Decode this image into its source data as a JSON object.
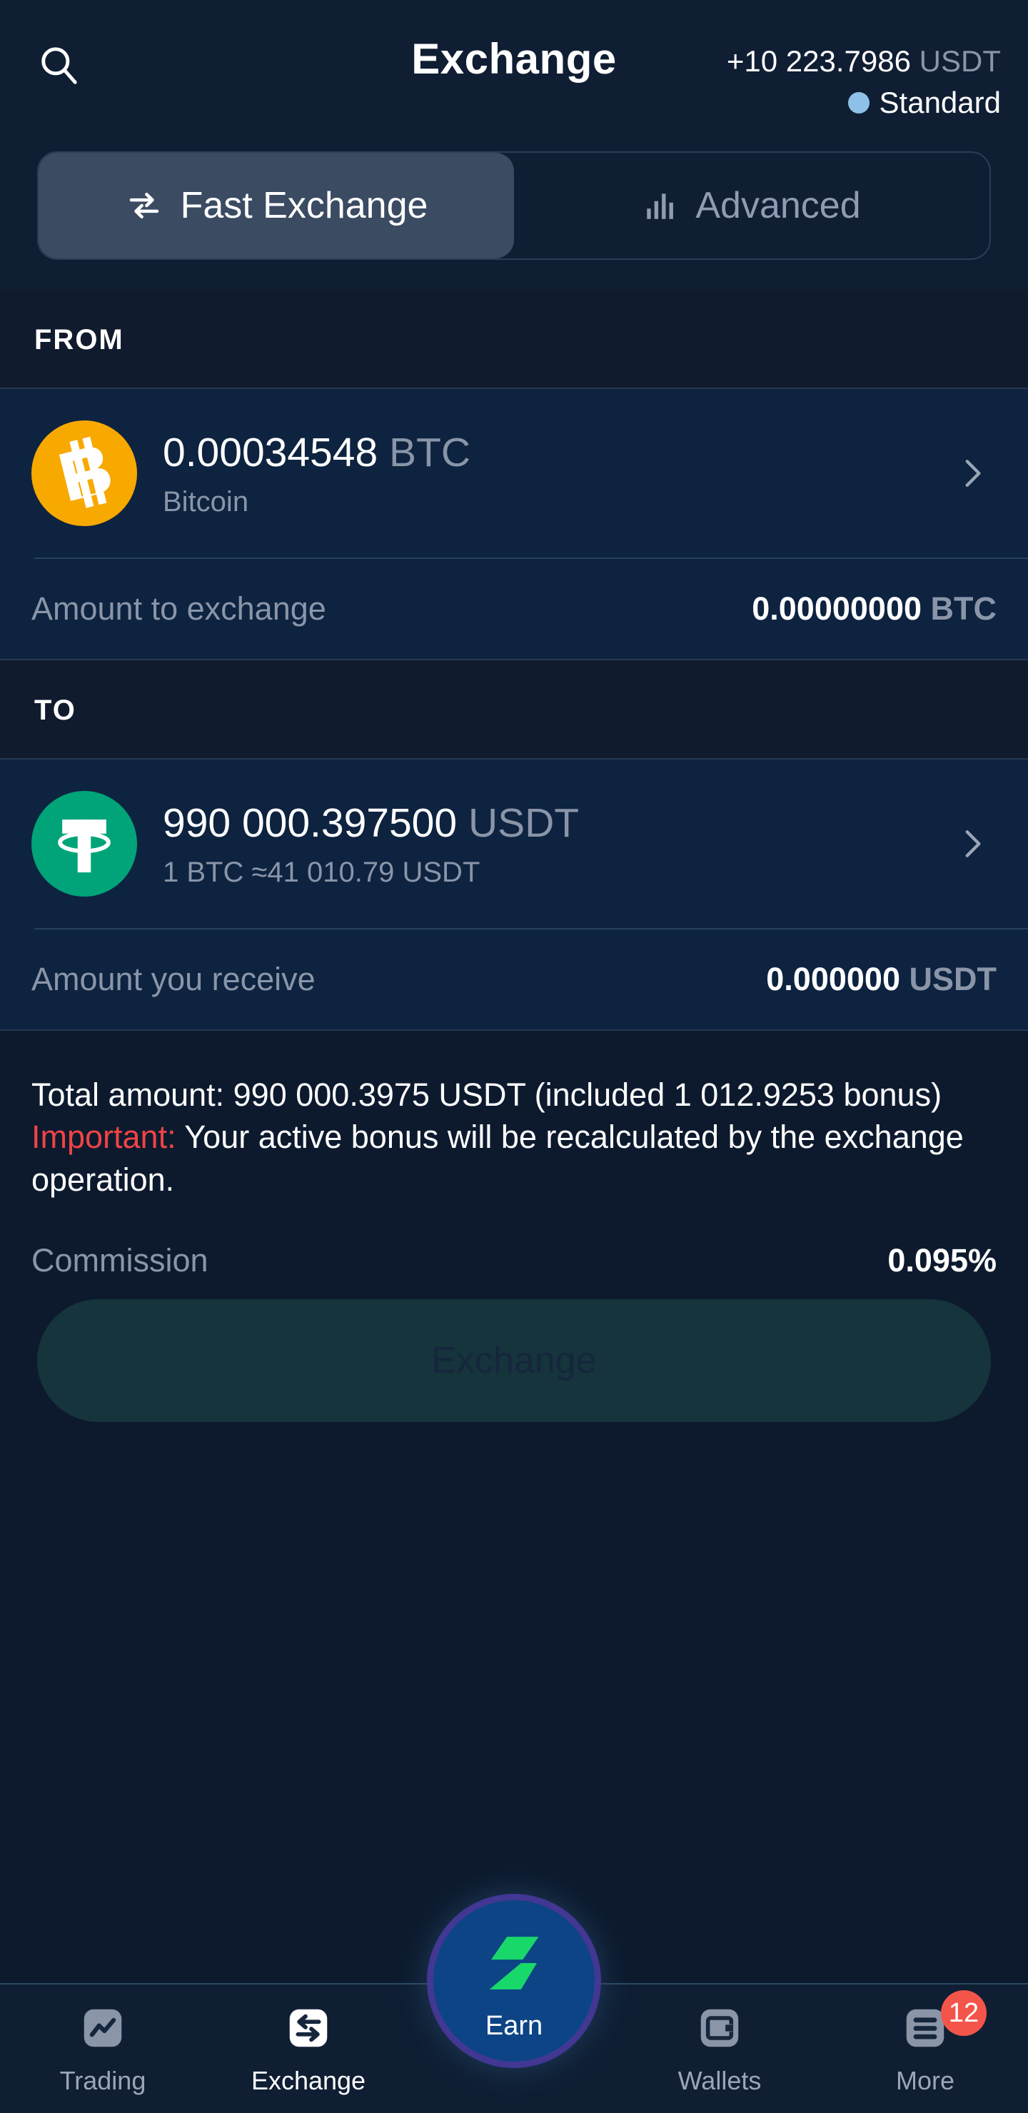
{
  "header": {
    "search_icon": "search-icon",
    "title": "Exchange",
    "balance_value": "+10 223.7986",
    "balance_currency": "USDT",
    "plan_name": "Standard",
    "plan_dot_color": "#8fc1e8"
  },
  "tabs": [
    {
      "label": "Fast Exchange",
      "icon": "swap-arrows-icon",
      "active": true
    },
    {
      "label": "Advanced",
      "icon": "bar-chart-icon",
      "active": false
    }
  ],
  "from": {
    "section_label": "FROM",
    "coin": {
      "icon": "bitcoin-icon",
      "icon_color": "#f7a900",
      "amount": "0.00034548",
      "symbol": "BTC",
      "name": "Bitcoin"
    },
    "amount_row": {
      "label": "Amount to exchange",
      "value": "0.00000000",
      "unit": "BTC"
    }
  },
  "to": {
    "section_label": "TO",
    "coin": {
      "icon": "tether-icon",
      "icon_color": "#00a478",
      "amount": "990 000.397500",
      "symbol": "USDT",
      "rate": "1 BTC ≈41 010.79 USDT"
    },
    "amount_row": {
      "label": "Amount you receive",
      "value": "0.000000",
      "unit": "USDT"
    }
  },
  "summary": {
    "total_line": "Total amount: 990 000.3975 USDT (included 1 012.9253 bonus)",
    "important_prefix": "Important:",
    "important_text": " Your active bonus will be recalculated by the exchange operation.",
    "important_color": "#ef4444",
    "commission_label": "Commission",
    "commission_value": "0.095%",
    "exchange_button": "Exchange"
  },
  "navbar": {
    "items": [
      {
        "label": "Trading",
        "icon": "chart-line-icon",
        "active": false
      },
      {
        "label": "Exchange",
        "icon": "swap-arrows-icon",
        "active": true
      },
      {
        "label": "Wallets",
        "icon": "wallet-icon",
        "active": false
      },
      {
        "label": "More",
        "icon": "list-menu-icon",
        "active": false,
        "badge": "12"
      }
    ],
    "earn": {
      "label": "Earn",
      "icon": "lightning-bolt-icon",
      "accent": "#19d86a"
    }
  }
}
